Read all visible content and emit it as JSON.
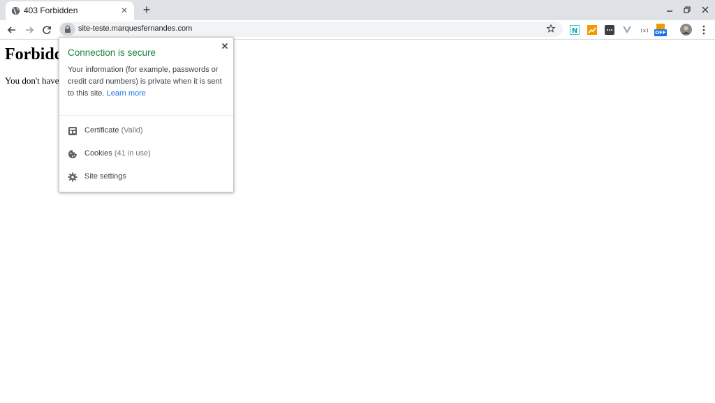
{
  "tab": {
    "title": "403 Forbidden",
    "favicon": "globe-icon"
  },
  "toolbar": {
    "url": "site-teste.marquesfernandes.com",
    "lock_icon": "lock-icon",
    "extensions": [
      "netflix-party-icon",
      "analytics-icon",
      "tab-manager-icon",
      "vue-devtools-icon",
      "wappalyzer-icon",
      "off-badge-icon"
    ],
    "off_badge": "OFF"
  },
  "page": {
    "heading": "Forbidden",
    "text": "You don't have"
  },
  "popup": {
    "title": "Connection is secure",
    "description": "Your information (for example, passwords or credit card numbers) is private when it is sent to this site.",
    "learn_more": "Learn more",
    "items": [
      {
        "label": "Certificate",
        "sub": "(Valid)",
        "icon": "certificate-icon"
      },
      {
        "label": "Cookies",
        "sub": "(41 in use)",
        "icon": "cookie-icon"
      },
      {
        "label": "Site settings",
        "sub": "",
        "icon": "gear-icon"
      }
    ]
  },
  "colors": {
    "secure_green": "#188038",
    "link_blue": "#1a73e8",
    "tabstrip": "#dee1e6"
  }
}
